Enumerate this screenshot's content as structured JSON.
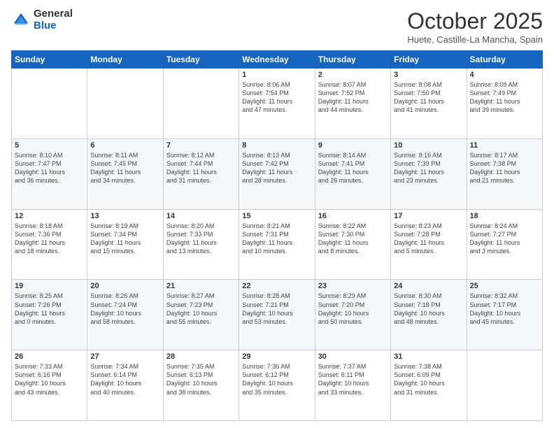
{
  "logo": {
    "general": "General",
    "blue": "Blue"
  },
  "title": "October 2025",
  "location": "Huete, Castille-La Mancha, Spain",
  "weekdays": [
    "Sunday",
    "Monday",
    "Tuesday",
    "Wednesday",
    "Thursday",
    "Friday",
    "Saturday"
  ],
  "weeks": [
    [
      {
        "day": "",
        "info": ""
      },
      {
        "day": "",
        "info": ""
      },
      {
        "day": "",
        "info": ""
      },
      {
        "day": "1",
        "info": "Sunrise: 8:06 AM\nSunset: 7:54 PM\nDaylight: 11 hours\nand 47 minutes."
      },
      {
        "day": "2",
        "info": "Sunrise: 8:07 AM\nSunset: 7:52 PM\nDaylight: 11 hours\nand 44 minutes."
      },
      {
        "day": "3",
        "info": "Sunrise: 8:08 AM\nSunset: 7:50 PM\nDaylight: 11 hours\nand 41 minutes."
      },
      {
        "day": "4",
        "info": "Sunrise: 8:09 AM\nSunset: 7:49 PM\nDaylight: 11 hours\nand 39 minutes."
      }
    ],
    [
      {
        "day": "5",
        "info": "Sunrise: 8:10 AM\nSunset: 7:47 PM\nDaylight: 11 hours\nand 36 minutes."
      },
      {
        "day": "6",
        "info": "Sunrise: 8:11 AM\nSunset: 7:45 PM\nDaylight: 11 hours\nand 34 minutes."
      },
      {
        "day": "7",
        "info": "Sunrise: 8:12 AM\nSunset: 7:44 PM\nDaylight: 11 hours\nand 31 minutes."
      },
      {
        "day": "8",
        "info": "Sunrise: 8:13 AM\nSunset: 7:42 PM\nDaylight: 11 hours\nand 28 minutes."
      },
      {
        "day": "9",
        "info": "Sunrise: 8:14 AM\nSunset: 7:41 PM\nDaylight: 11 hours\nand 26 minutes."
      },
      {
        "day": "10",
        "info": "Sunrise: 8:16 AM\nSunset: 7:39 PM\nDaylight: 11 hours\nand 23 minutes."
      },
      {
        "day": "11",
        "info": "Sunrise: 8:17 AM\nSunset: 7:38 PM\nDaylight: 11 hours\nand 21 minutes."
      }
    ],
    [
      {
        "day": "12",
        "info": "Sunrise: 8:18 AM\nSunset: 7:36 PM\nDaylight: 11 hours\nand 18 minutes."
      },
      {
        "day": "13",
        "info": "Sunrise: 8:19 AM\nSunset: 7:34 PM\nDaylight: 11 hours\nand 15 minutes."
      },
      {
        "day": "14",
        "info": "Sunrise: 8:20 AM\nSunset: 7:33 PM\nDaylight: 11 hours\nand 13 minutes."
      },
      {
        "day": "15",
        "info": "Sunrise: 8:21 AM\nSunset: 7:31 PM\nDaylight: 11 hours\nand 10 minutes."
      },
      {
        "day": "16",
        "info": "Sunrise: 8:22 AM\nSunset: 7:30 PM\nDaylight: 11 hours\nand 8 minutes."
      },
      {
        "day": "17",
        "info": "Sunrise: 8:23 AM\nSunset: 7:28 PM\nDaylight: 11 hours\nand 5 minutes."
      },
      {
        "day": "18",
        "info": "Sunrise: 8:24 AM\nSunset: 7:27 PM\nDaylight: 11 hours\nand 3 minutes."
      }
    ],
    [
      {
        "day": "19",
        "info": "Sunrise: 8:25 AM\nSunset: 7:26 PM\nDaylight: 11 hours\nand 0 minutes."
      },
      {
        "day": "20",
        "info": "Sunrise: 8:26 AM\nSunset: 7:24 PM\nDaylight: 10 hours\nand 58 minutes."
      },
      {
        "day": "21",
        "info": "Sunrise: 8:27 AM\nSunset: 7:23 PM\nDaylight: 10 hours\nand 55 minutes."
      },
      {
        "day": "22",
        "info": "Sunrise: 8:28 AM\nSunset: 7:21 PM\nDaylight: 10 hours\nand 53 minutes."
      },
      {
        "day": "23",
        "info": "Sunrise: 8:29 AM\nSunset: 7:20 PM\nDaylight: 10 hours\nand 50 minutes."
      },
      {
        "day": "24",
        "info": "Sunrise: 8:30 AM\nSunset: 7:18 PM\nDaylight: 10 hours\nand 48 minutes."
      },
      {
        "day": "25",
        "info": "Sunrise: 8:32 AM\nSunset: 7:17 PM\nDaylight: 10 hours\nand 45 minutes."
      }
    ],
    [
      {
        "day": "26",
        "info": "Sunrise: 7:33 AM\nSunset: 6:16 PM\nDaylight: 10 hours\nand 43 minutes."
      },
      {
        "day": "27",
        "info": "Sunrise: 7:34 AM\nSunset: 6:14 PM\nDaylight: 10 hours\nand 40 minutes."
      },
      {
        "day": "28",
        "info": "Sunrise: 7:35 AM\nSunset: 6:13 PM\nDaylight: 10 hours\nand 38 minutes."
      },
      {
        "day": "29",
        "info": "Sunrise: 7:36 AM\nSunset: 6:12 PM\nDaylight: 10 hours\nand 35 minutes."
      },
      {
        "day": "30",
        "info": "Sunrise: 7:37 AM\nSunset: 6:11 PM\nDaylight: 10 hours\nand 33 minutes."
      },
      {
        "day": "31",
        "info": "Sunrise: 7:38 AM\nSunset: 6:09 PM\nDaylight: 10 hours\nand 31 minutes."
      },
      {
        "day": "",
        "info": ""
      }
    ]
  ]
}
